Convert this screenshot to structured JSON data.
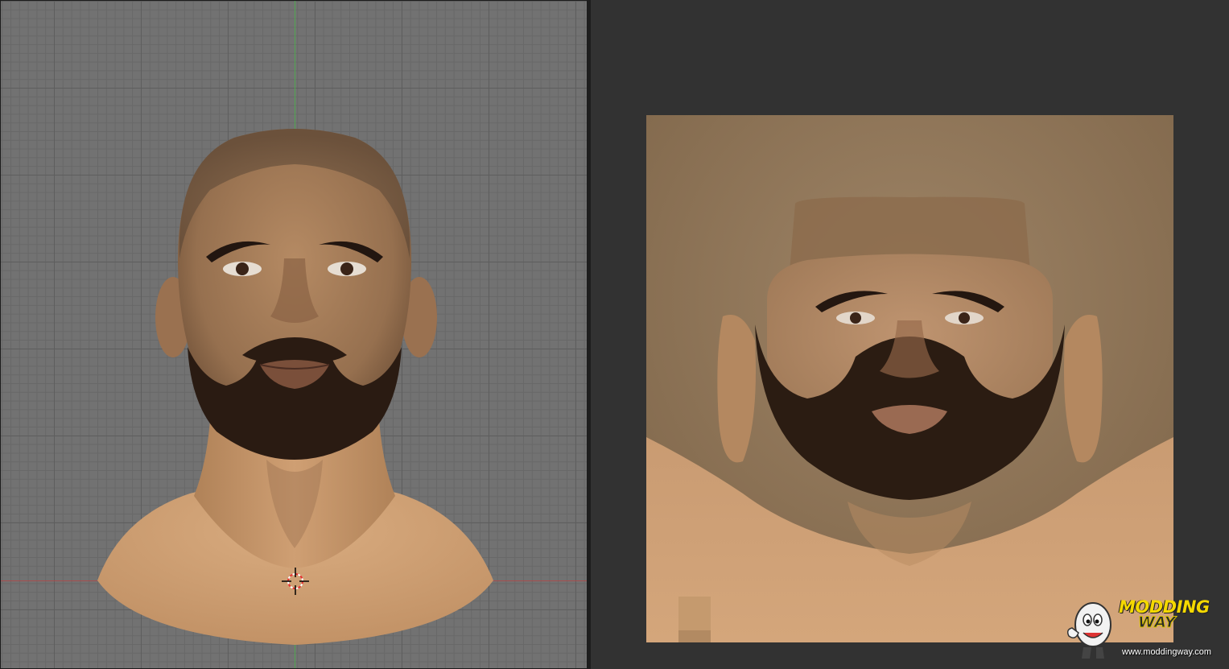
{
  "viewport": {
    "background_color": "#727272",
    "grid_color": "#5e5e5e",
    "axis_y_color": "#4bb04b",
    "axis_x_color": "#b04848",
    "icons": [
      "3d-cursor-icon"
    ]
  },
  "image_editor": {
    "background_color": "#323232",
    "texture_background": "#8a7257"
  },
  "watermark": {
    "logo_word_1": "MODDING",
    "logo_word_2": "WAY",
    "url": "www.moddingway.com",
    "brand_color": "#f4d800"
  }
}
